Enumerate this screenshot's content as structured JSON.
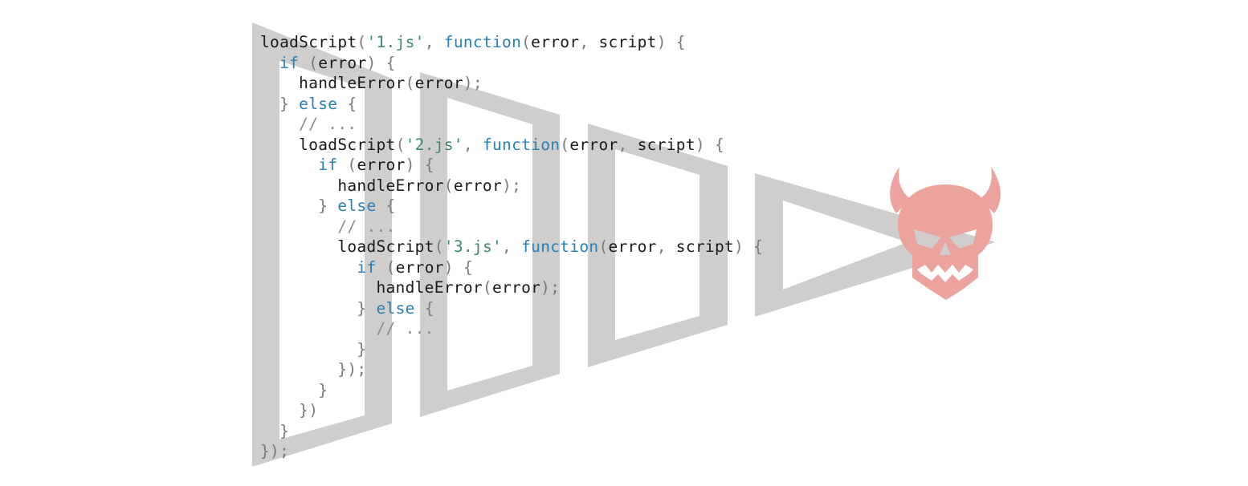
{
  "colors": {
    "trapezoid_gray": "#cfcecd",
    "skull_red": "#eca39e",
    "keyword_blue": "#2a7fb3",
    "string_green": "#3d8a6a",
    "punct_gray": "#7a7a7a",
    "comment_gray": "#8c8c8c"
  },
  "icons": {
    "skull": "devil-skull-icon"
  },
  "code_lines": [
    [
      {
        "t": "plain",
        "v": "loadScript"
      },
      {
        "t": "punct",
        "v": "("
      },
      {
        "t": "string",
        "v": "'1.js'"
      },
      {
        "t": "punct",
        "v": ", "
      },
      {
        "t": "keyword",
        "v": "function"
      },
      {
        "t": "punct",
        "v": "("
      },
      {
        "t": "plain",
        "v": "error"
      },
      {
        "t": "punct",
        "v": ", "
      },
      {
        "t": "plain",
        "v": "script"
      },
      {
        "t": "punct",
        "v": ") {"
      }
    ],
    [
      {
        "t": "plain",
        "v": "  "
      },
      {
        "t": "keyword",
        "v": "if"
      },
      {
        "t": "punct",
        "v": " ("
      },
      {
        "t": "plain",
        "v": "error"
      },
      {
        "t": "punct",
        "v": ") {"
      }
    ],
    [
      {
        "t": "plain",
        "v": "    handleError"
      },
      {
        "t": "punct",
        "v": "("
      },
      {
        "t": "plain",
        "v": "error"
      },
      {
        "t": "punct",
        "v": ");"
      }
    ],
    [
      {
        "t": "punct",
        "v": "  } "
      },
      {
        "t": "keyword",
        "v": "else"
      },
      {
        "t": "punct",
        "v": " {"
      }
    ],
    [
      {
        "t": "comment",
        "v": "    // ..."
      }
    ],
    [
      {
        "t": "plain",
        "v": "    loadScript"
      },
      {
        "t": "punct",
        "v": "("
      },
      {
        "t": "string",
        "v": "'2.js'"
      },
      {
        "t": "punct",
        "v": ", "
      },
      {
        "t": "keyword",
        "v": "function"
      },
      {
        "t": "punct",
        "v": "("
      },
      {
        "t": "plain",
        "v": "error"
      },
      {
        "t": "punct",
        "v": ", "
      },
      {
        "t": "plain",
        "v": "script"
      },
      {
        "t": "punct",
        "v": ") {"
      }
    ],
    [
      {
        "t": "plain",
        "v": "      "
      },
      {
        "t": "keyword",
        "v": "if"
      },
      {
        "t": "punct",
        "v": " ("
      },
      {
        "t": "plain",
        "v": "error"
      },
      {
        "t": "punct",
        "v": ") {"
      }
    ],
    [
      {
        "t": "plain",
        "v": "        handleError"
      },
      {
        "t": "punct",
        "v": "("
      },
      {
        "t": "plain",
        "v": "error"
      },
      {
        "t": "punct",
        "v": ");"
      }
    ],
    [
      {
        "t": "punct",
        "v": "      } "
      },
      {
        "t": "keyword",
        "v": "else"
      },
      {
        "t": "punct",
        "v": " {"
      }
    ],
    [
      {
        "t": "comment",
        "v": "        // ..."
      }
    ],
    [
      {
        "t": "plain",
        "v": "        loadScript"
      },
      {
        "t": "punct",
        "v": "("
      },
      {
        "t": "string",
        "v": "'3.js'"
      },
      {
        "t": "punct",
        "v": ", "
      },
      {
        "t": "keyword",
        "v": "function"
      },
      {
        "t": "punct",
        "v": "("
      },
      {
        "t": "plain",
        "v": "error"
      },
      {
        "t": "punct",
        "v": ", "
      },
      {
        "t": "plain",
        "v": "script"
      },
      {
        "t": "punct",
        "v": ") {"
      }
    ],
    [
      {
        "t": "plain",
        "v": "          "
      },
      {
        "t": "keyword",
        "v": "if"
      },
      {
        "t": "punct",
        "v": " ("
      },
      {
        "t": "plain",
        "v": "error"
      },
      {
        "t": "punct",
        "v": ") {"
      }
    ],
    [
      {
        "t": "plain",
        "v": "            handleError"
      },
      {
        "t": "punct",
        "v": "("
      },
      {
        "t": "plain",
        "v": "error"
      },
      {
        "t": "punct",
        "v": ");"
      }
    ],
    [
      {
        "t": "punct",
        "v": "          } "
      },
      {
        "t": "keyword",
        "v": "else"
      },
      {
        "t": "punct",
        "v": " {"
      }
    ],
    [
      {
        "t": "comment",
        "v": "            // ..."
      }
    ],
    [
      {
        "t": "punct",
        "v": "          }"
      }
    ],
    [
      {
        "t": "punct",
        "v": "        });"
      }
    ],
    [
      {
        "t": "punct",
        "v": "      }"
      }
    ],
    [
      {
        "t": "punct",
        "v": "    })"
      }
    ],
    [
      {
        "t": "punct",
        "v": "  }"
      }
    ],
    [
      {
        "t": "punct",
        "v": "});"
      }
    ]
  ]
}
